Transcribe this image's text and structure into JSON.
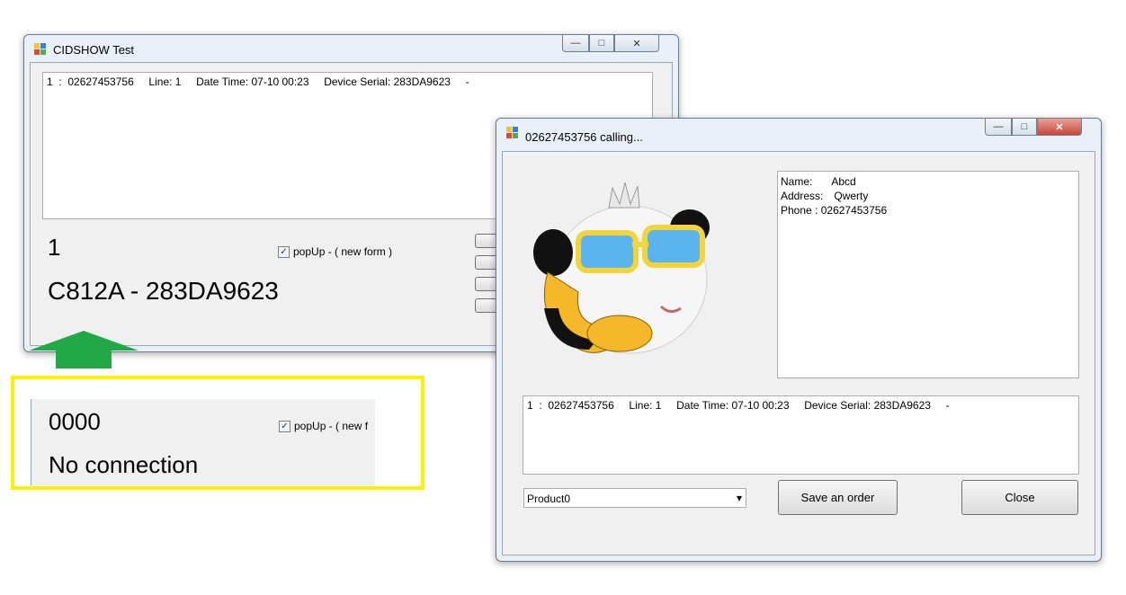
{
  "main_window": {
    "title": "CIDSHOW Test",
    "log_line": "1  :  02627453756     Line: 1     Date Time: 07-10 00:23     Device Serial: 283DA9623     -",
    "count": "1",
    "popup_label": "popUp - ( new form )",
    "popup_checked": "✓",
    "device_text": "C812A - 283DA9623"
  },
  "callout": {
    "count": "0000",
    "popup_label": "popUp - ( new f",
    "popup_checked": "✓",
    "status_text": "No connection"
  },
  "popup_window": {
    "title": "02627453756  calling...",
    "info_name_label": "Name:",
    "info_name_value": "Abcd",
    "info_address_label": "Address:",
    "info_address_value": "Qwerty",
    "info_phone_label": "Phone :",
    "info_phone_value": "02627453756",
    "log_line": "1  :  02627453756     Line: 1     Date Time: 07-10 00:23     Device Serial: 283DA9623     -",
    "product_selected": "Product0",
    "save_label": "Save an order",
    "close_label": "Close"
  },
  "glyphs": {
    "minimize": "—",
    "maximize": "□",
    "close": "✕",
    "dropdown": "▾"
  },
  "colors": {
    "highlight_box": "#ffef00",
    "arrow": "#22a847"
  }
}
